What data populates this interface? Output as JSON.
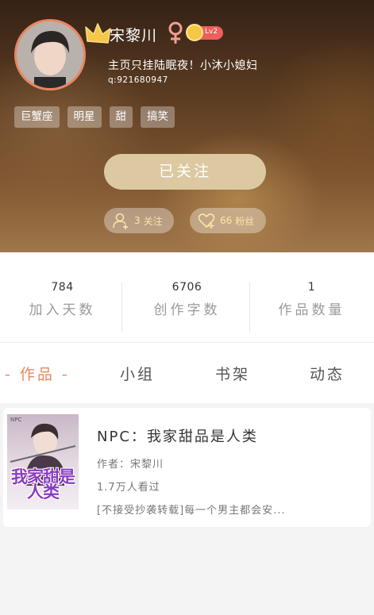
{
  "profile": {
    "username": "宋黎川",
    "gender_symbol": "♀",
    "level_label": "Lv2",
    "bio": "主页只挂陆眠夜！小沐小媳妇",
    "qq": "q:921680947",
    "tags": [
      "巨蟹座",
      "明星",
      "甜",
      "搞笑"
    ],
    "follow_button_label": "已关注",
    "following_count": "3",
    "following_label": "关注",
    "fans_count": "66",
    "fans_label": "粉丝"
  },
  "stats": [
    {
      "value": "784",
      "label": "加入天数"
    },
    {
      "value": "6706",
      "label": "创作字数"
    },
    {
      "value": "1",
      "label": "作品数量"
    }
  ],
  "tabs": [
    {
      "label": "- 作品 -",
      "active": true
    },
    {
      "label": "小组",
      "active": false
    },
    {
      "label": "书架",
      "active": false
    },
    {
      "label": "动态",
      "active": false
    }
  ],
  "works": [
    {
      "title": "NPC：我家甜品是人类",
      "cover_text": "我家甜是人类",
      "cover_mark": "NPC",
      "author": "作者：宋黎川",
      "reads": "1.7万人看过",
      "description": "[不接受抄袭转载]每一个男主都会安..."
    }
  ],
  "colors": {
    "accent": "#e8875f",
    "follow_button": "#dcc9a2",
    "level_badge": "#ee5e5a",
    "pill_text": "#f8e7a6"
  },
  "icons": {
    "crown": "crown-icon",
    "gender": "female-symbol-icon",
    "following": "user-plus-icon",
    "fans": "heart-plus-icon"
  }
}
